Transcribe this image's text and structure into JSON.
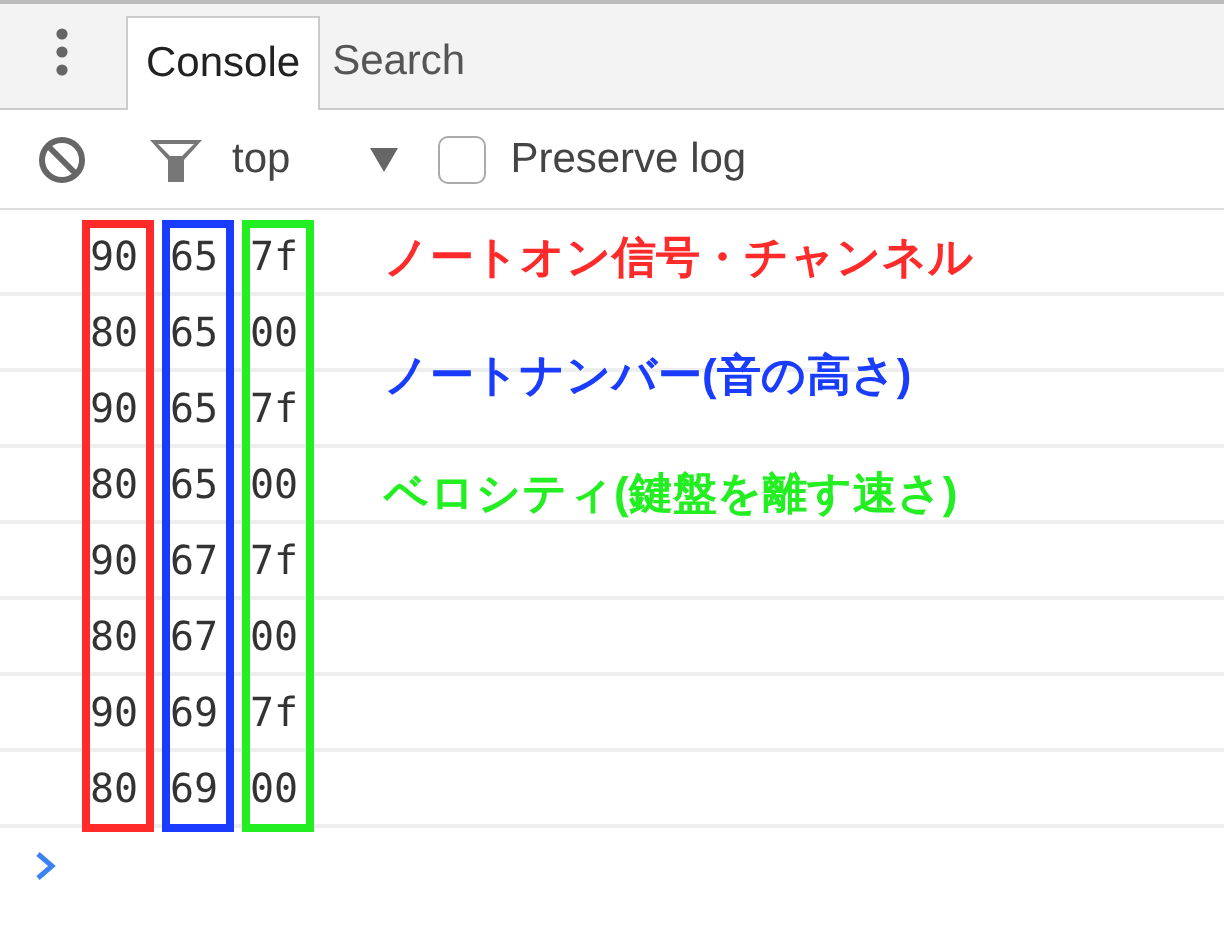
{
  "tabs": [
    {
      "label": "Console",
      "selected": true
    },
    {
      "label": "Search",
      "selected": false
    }
  ],
  "toolbar": {
    "context": "top",
    "preserve_log": {
      "label": "Preserve log",
      "checked": false
    }
  },
  "rows": [
    [
      "90",
      "65",
      "7f"
    ],
    [
      "80",
      "65",
      "00"
    ],
    [
      "90",
      "65",
      "7f"
    ],
    [
      "80",
      "65",
      "00"
    ],
    [
      "90",
      "67",
      "7f"
    ],
    [
      "80",
      "67",
      "00"
    ],
    [
      "90",
      "69",
      "7f"
    ],
    [
      "80",
      "69",
      "00"
    ]
  ],
  "annotations": [
    {
      "text": "ノートオン信号・チャンネル",
      "color": "#ff2a2a"
    },
    {
      "text": "ノートナンバー(音の高さ)",
      "color": "#1a3cff"
    },
    {
      "text": "ベロシティ(鍵盤を離す速さ)",
      "color": "#22ee22"
    }
  ]
}
